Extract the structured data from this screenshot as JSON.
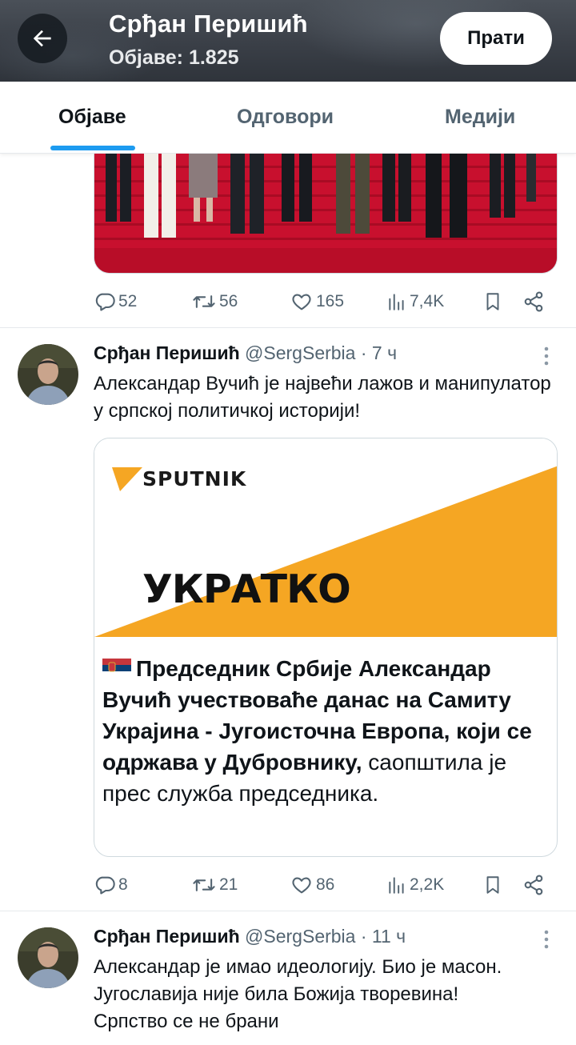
{
  "header": {
    "title": "Срђан Перишић",
    "subtitle": "Објаве: 1.825",
    "follow_label": "Прати"
  },
  "tabs": [
    {
      "label": "Објаве",
      "active": true
    },
    {
      "label": "Одговори",
      "active": false
    },
    {
      "label": "Медији",
      "active": false
    }
  ],
  "top_tweet_actions": {
    "replies": "52",
    "retweets": "56",
    "likes": "165",
    "views": "7,4K"
  },
  "tweet1": {
    "name": "Срђан Перишић",
    "handle": "@SergSerbia",
    "time": "· 7 ч",
    "text": "Александар Вучић је највећи лажов и манипулатор у српској политичкој историји!",
    "card": {
      "brand": "SPUTNIK",
      "headline_image_text": "УКРАТКО",
      "bold_text": "Председник Србије Александар Вучић учествоваће данас на Самиту Украјина - Југоисточна Европа, који се одржава у Дубровнику,",
      "regular_text": " саопштила је прес служба председника."
    },
    "actions": {
      "replies": "8",
      "retweets": "21",
      "likes": "86",
      "views": "2,2K"
    }
  },
  "tweet2": {
    "name": "Срђан Перишић",
    "handle": "@SergSerbia",
    "time": "· 11 ч",
    "text": "Александар је имао идеологију. Био је масон. Југославија није била Божија творевина! Српство се не брани"
  },
  "colors": {
    "accent": "#1d9bf0",
    "muted": "#536471",
    "sputnik_orange": "#f5a623",
    "carpet_red": "#c8102e"
  }
}
